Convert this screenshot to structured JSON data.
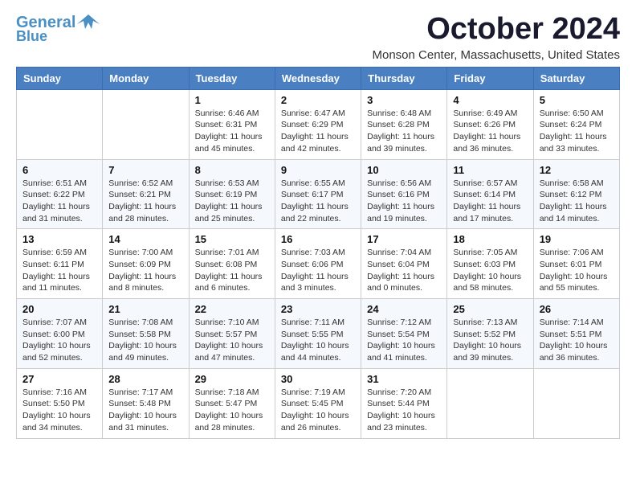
{
  "logo": {
    "line1": "General",
    "line2": "Blue"
  },
  "header": {
    "title": "October 2024",
    "location": "Monson Center, Massachusetts, United States"
  },
  "weekdays": [
    "Sunday",
    "Monday",
    "Tuesday",
    "Wednesday",
    "Thursday",
    "Friday",
    "Saturday"
  ],
  "weeks": [
    [
      {
        "day": "",
        "info": ""
      },
      {
        "day": "",
        "info": ""
      },
      {
        "day": "1",
        "info": "Sunrise: 6:46 AM\nSunset: 6:31 PM\nDaylight: 11 hours and 45 minutes."
      },
      {
        "day": "2",
        "info": "Sunrise: 6:47 AM\nSunset: 6:29 PM\nDaylight: 11 hours and 42 minutes."
      },
      {
        "day": "3",
        "info": "Sunrise: 6:48 AM\nSunset: 6:28 PM\nDaylight: 11 hours and 39 minutes."
      },
      {
        "day": "4",
        "info": "Sunrise: 6:49 AM\nSunset: 6:26 PM\nDaylight: 11 hours and 36 minutes."
      },
      {
        "day": "5",
        "info": "Sunrise: 6:50 AM\nSunset: 6:24 PM\nDaylight: 11 hours and 33 minutes."
      }
    ],
    [
      {
        "day": "6",
        "info": "Sunrise: 6:51 AM\nSunset: 6:22 PM\nDaylight: 11 hours and 31 minutes."
      },
      {
        "day": "7",
        "info": "Sunrise: 6:52 AM\nSunset: 6:21 PM\nDaylight: 11 hours and 28 minutes."
      },
      {
        "day": "8",
        "info": "Sunrise: 6:53 AM\nSunset: 6:19 PM\nDaylight: 11 hours and 25 minutes."
      },
      {
        "day": "9",
        "info": "Sunrise: 6:55 AM\nSunset: 6:17 PM\nDaylight: 11 hours and 22 minutes."
      },
      {
        "day": "10",
        "info": "Sunrise: 6:56 AM\nSunset: 6:16 PM\nDaylight: 11 hours and 19 minutes."
      },
      {
        "day": "11",
        "info": "Sunrise: 6:57 AM\nSunset: 6:14 PM\nDaylight: 11 hours and 17 minutes."
      },
      {
        "day": "12",
        "info": "Sunrise: 6:58 AM\nSunset: 6:12 PM\nDaylight: 11 hours and 14 minutes."
      }
    ],
    [
      {
        "day": "13",
        "info": "Sunrise: 6:59 AM\nSunset: 6:11 PM\nDaylight: 11 hours and 11 minutes."
      },
      {
        "day": "14",
        "info": "Sunrise: 7:00 AM\nSunset: 6:09 PM\nDaylight: 11 hours and 8 minutes."
      },
      {
        "day": "15",
        "info": "Sunrise: 7:01 AM\nSunset: 6:08 PM\nDaylight: 11 hours and 6 minutes."
      },
      {
        "day": "16",
        "info": "Sunrise: 7:03 AM\nSunset: 6:06 PM\nDaylight: 11 hours and 3 minutes."
      },
      {
        "day": "17",
        "info": "Sunrise: 7:04 AM\nSunset: 6:04 PM\nDaylight: 11 hours and 0 minutes."
      },
      {
        "day": "18",
        "info": "Sunrise: 7:05 AM\nSunset: 6:03 PM\nDaylight: 10 hours and 58 minutes."
      },
      {
        "day": "19",
        "info": "Sunrise: 7:06 AM\nSunset: 6:01 PM\nDaylight: 10 hours and 55 minutes."
      }
    ],
    [
      {
        "day": "20",
        "info": "Sunrise: 7:07 AM\nSunset: 6:00 PM\nDaylight: 10 hours and 52 minutes."
      },
      {
        "day": "21",
        "info": "Sunrise: 7:08 AM\nSunset: 5:58 PM\nDaylight: 10 hours and 49 minutes."
      },
      {
        "day": "22",
        "info": "Sunrise: 7:10 AM\nSunset: 5:57 PM\nDaylight: 10 hours and 47 minutes."
      },
      {
        "day": "23",
        "info": "Sunrise: 7:11 AM\nSunset: 5:55 PM\nDaylight: 10 hours and 44 minutes."
      },
      {
        "day": "24",
        "info": "Sunrise: 7:12 AM\nSunset: 5:54 PM\nDaylight: 10 hours and 41 minutes."
      },
      {
        "day": "25",
        "info": "Sunrise: 7:13 AM\nSunset: 5:52 PM\nDaylight: 10 hours and 39 minutes."
      },
      {
        "day": "26",
        "info": "Sunrise: 7:14 AM\nSunset: 5:51 PM\nDaylight: 10 hours and 36 minutes."
      }
    ],
    [
      {
        "day": "27",
        "info": "Sunrise: 7:16 AM\nSunset: 5:50 PM\nDaylight: 10 hours and 34 minutes."
      },
      {
        "day": "28",
        "info": "Sunrise: 7:17 AM\nSunset: 5:48 PM\nDaylight: 10 hours and 31 minutes."
      },
      {
        "day": "29",
        "info": "Sunrise: 7:18 AM\nSunset: 5:47 PM\nDaylight: 10 hours and 28 minutes."
      },
      {
        "day": "30",
        "info": "Sunrise: 7:19 AM\nSunset: 5:45 PM\nDaylight: 10 hours and 26 minutes."
      },
      {
        "day": "31",
        "info": "Sunrise: 7:20 AM\nSunset: 5:44 PM\nDaylight: 10 hours and 23 minutes."
      },
      {
        "day": "",
        "info": ""
      },
      {
        "day": "",
        "info": ""
      }
    ]
  ]
}
